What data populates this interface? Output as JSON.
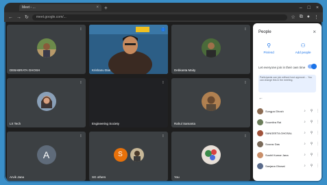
{
  "browser": {
    "tab_title": "Meet - ...",
    "url": "meet.google.com/..."
  },
  "tiles": [
    {
      "name": "DEBABRATA GHOSH",
      "mic": "mic-off"
    },
    {
      "name": "Krishanu Das",
      "mic": "speaking"
    },
    {
      "name": "Debkanta Maity",
      "mic": "mic-off"
    },
    {
      "name": "LX Tech",
      "mic": "mic-off"
    },
    {
      "name": "Engineering Society",
      "mic": "mic-off"
    },
    {
      "name": "Rahul Samanta",
      "mic": "mic-off"
    },
    {
      "name": "Arvik Jana",
      "initial": "A",
      "mic": "mic-off"
    },
    {
      "name": "SG others",
      "initial": "S",
      "mic": "mic-off"
    },
    {
      "name": "You",
      "mic": "mic-off"
    }
  ],
  "panel": {
    "title": "People",
    "add_people": "Add people",
    "pin_label": "Pin/end",
    "waiting_room": "Let everyone join in their own time",
    "notice": "Participants can join without host approval ... You can change this in the meeting.",
    "participants": [
      {
        "name": "Sungpa Ghosh",
        "color": "#8b6b52"
      },
      {
        "name": "Soumitra Rai",
        "color": "#6b7d5a"
      },
      {
        "name": "SANGEETA GHOSAL",
        "color": "#a0523a"
      },
      {
        "name": "Sourav Das",
        "color": "#7a6a5a"
      },
      {
        "name": "Sushil Kumar Jana",
        "color": "#c98f6a"
      },
      {
        "name": "Sanjana Ghosal",
        "color": "#5a6b8b"
      }
    ]
  }
}
